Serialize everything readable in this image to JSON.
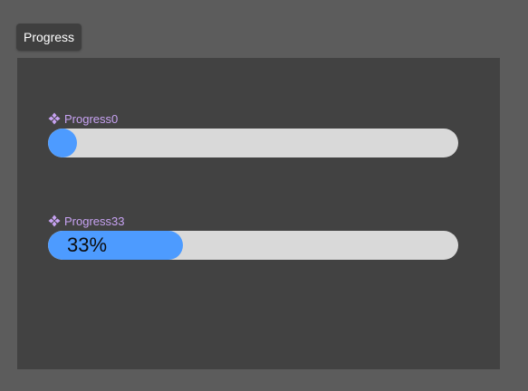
{
  "page_tab": {
    "label": "Progress"
  },
  "colors": {
    "fill": "#4d9bff",
    "track": "#d9d9d9",
    "component_label": "#c7a2f2"
  },
  "components": [
    {
      "name": "Progress0",
      "icon": "component-icon",
      "progress": 0,
      "label": ""
    },
    {
      "name": "Progress33",
      "icon": "component-icon",
      "progress": 0.33,
      "label": "33%"
    }
  ]
}
